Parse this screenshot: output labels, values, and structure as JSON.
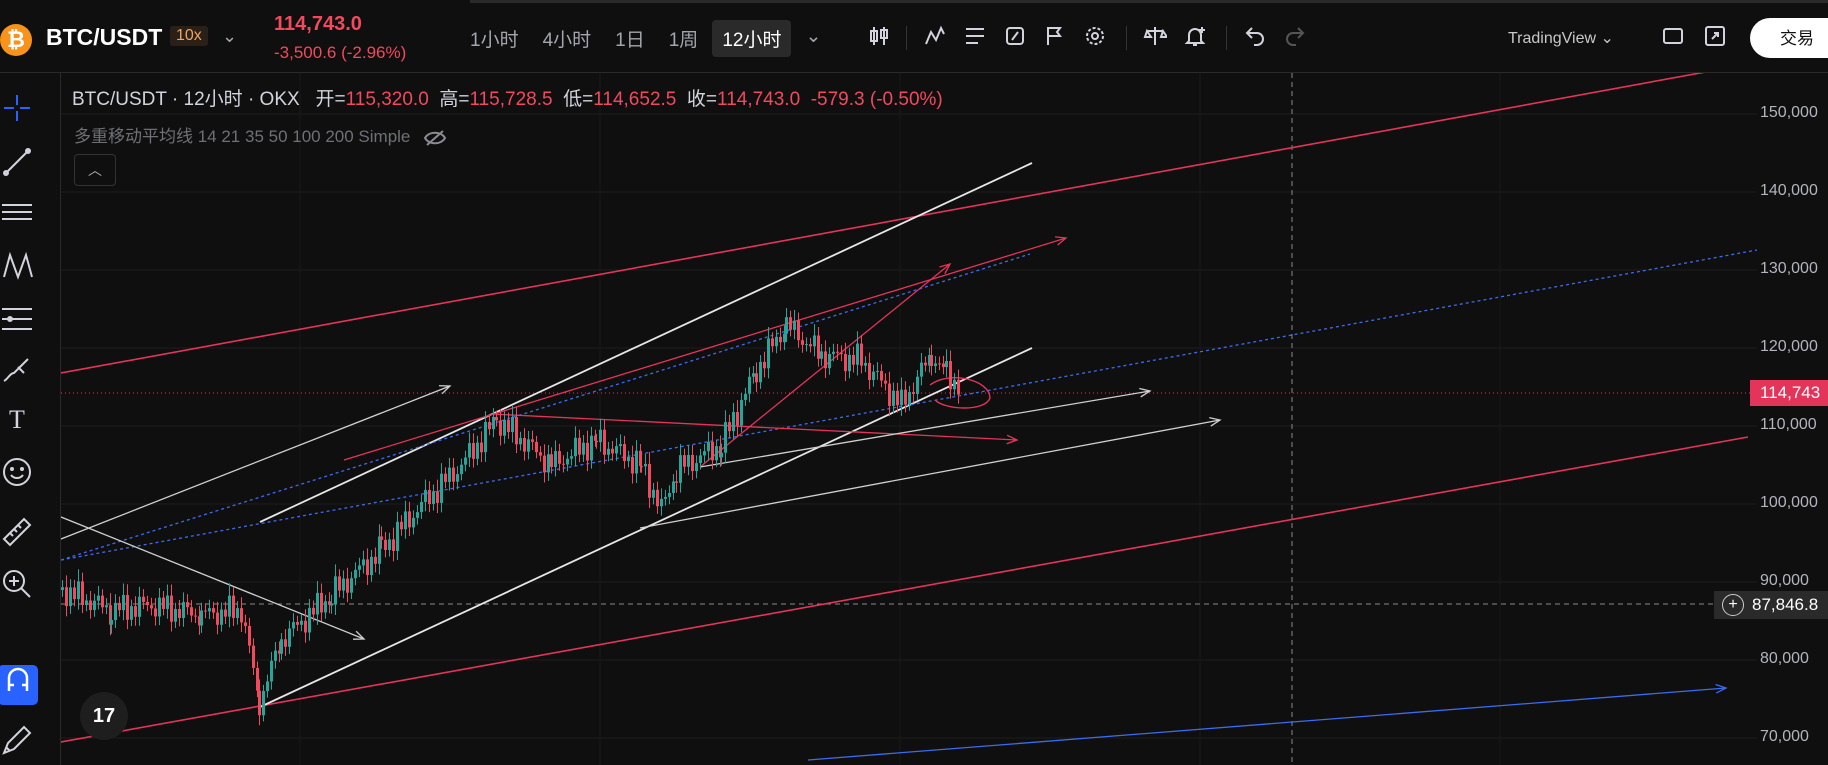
{
  "header": {
    "coin_glyph": "₿",
    "pair": "BTC/USDT",
    "leverage": "10x",
    "price": "114,743.0",
    "change": "-3,500.6 (-2.96%)",
    "intervals": [
      "1小时",
      "4小时",
      "1日",
      "1周",
      "12小时"
    ],
    "active_interval": "12小时",
    "provider": "TradingView",
    "trade_button": "交易"
  },
  "legend": {
    "symbol": "BTC/USDT · 12小时 · OKX",
    "open_label": "开=",
    "open": "115,320.0",
    "high_label": "高=",
    "high": "115,728.5",
    "low_label": "低=",
    "low": "114,652.5",
    "close_label": "收=",
    "close": "114,743.0",
    "change": "-579.3 (-0.50%)",
    "ma": "多重移动平均线 14 21 35 50 100 200 Simple"
  },
  "price_axis": [
    "150,000",
    "140,000",
    "130,000",
    "120,000",
    "110,000",
    "100,000",
    "90,000",
    "80,000",
    "70,000"
  ],
  "current_price_tag": "114,743",
  "crosshair_price": "87,846.8",
  "tv_logo": "17",
  "colors": {
    "up": "#26a69a",
    "down": "#f2495e",
    "accent": "#2962ff",
    "channel": "#e5345a"
  }
}
